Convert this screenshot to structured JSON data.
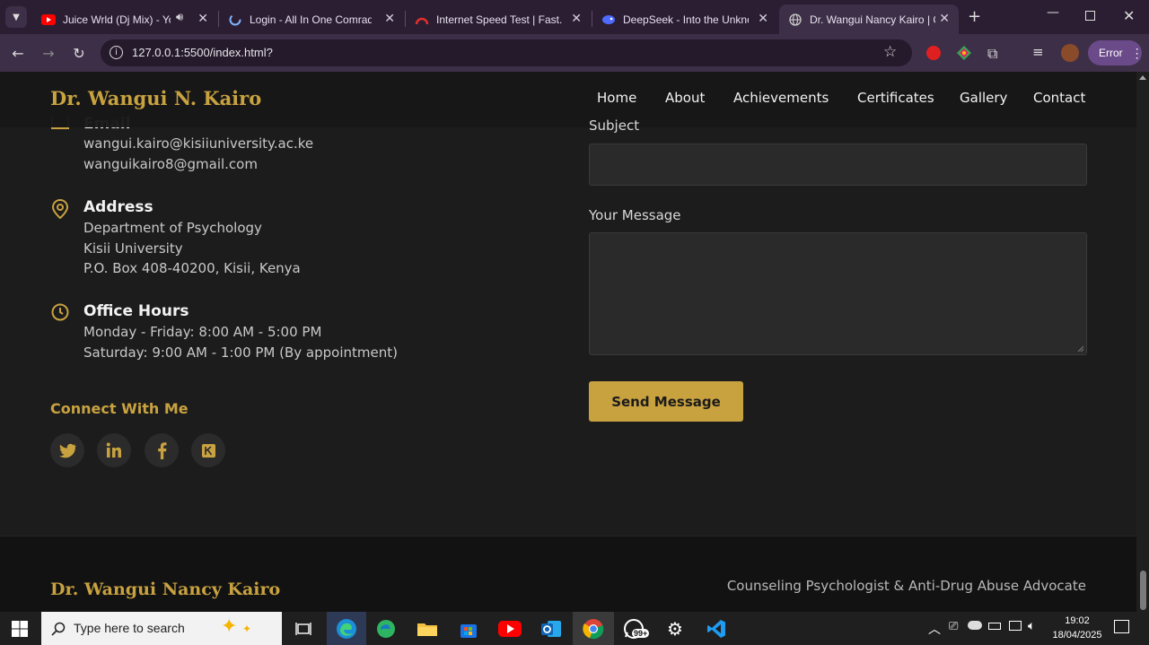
{
  "browser": {
    "tabs": [
      {
        "title": "Juice Wrld (Dj Mix) - You",
        "favicon": "youtube-icon",
        "close": "✕"
      },
      {
        "title": "Login - All In One Comrade",
        "favicon": "loading-icon",
        "close": "✕"
      },
      {
        "title": "Internet Speed Test | Fast.co",
        "favicon": "speedometer-icon",
        "close": "✕"
      },
      {
        "title": "DeepSeek - Into the Unknow",
        "favicon": "deepseek-icon",
        "close": "✕"
      },
      {
        "title": "Dr. Wangui Nancy Kairo | Co",
        "favicon": "globe-icon",
        "close": "✕"
      }
    ],
    "url": "127.0.0.1:5500/index.html?",
    "error_label": "Error",
    "colors": {
      "frame": "#2b1e33",
      "toolbar": "#3d2f47"
    }
  },
  "site": {
    "brand": "Dr. Wangui N. Kairo",
    "nav": [
      "Home",
      "About",
      "Achievements",
      "Certificates",
      "Gallery",
      "Contact"
    ],
    "email": {
      "heading": "Email",
      "lines": [
        "wangui.kairo@kisiiuniversity.ac.ke",
        "wanguikairo8@gmail.com"
      ]
    },
    "address": {
      "heading": "Address",
      "lines": [
        "Department of Psychology",
        "Kisii University",
        "P.O. Box 408-40200, Kisii, Kenya"
      ]
    },
    "hours": {
      "heading": "Office Hours",
      "lines": [
        "Monday - Friday: 8:00 AM - 5:00 PM",
        "Saturday: 9:00 AM - 1:00 PM (By appointment)"
      ]
    },
    "connect_heading": "Connect With Me",
    "social": [
      "twitter-icon",
      "linkedin-icon",
      "facebook-icon",
      "google-scholar-icon"
    ],
    "form": {
      "subject_label": "Subject",
      "message_label": "Your Message",
      "send_label": "Send Message"
    },
    "footer": {
      "brand": "Dr. Wangui Nancy Kairo",
      "tagline": "Counseling Psychologist & Anti-Drug Abuse Advocate"
    },
    "colors": {
      "gold": "#c9a240",
      "background": "#1c1c1c"
    }
  },
  "taskbar": {
    "search_placeholder": "Type here to search",
    "whatsapp_badge": "99+",
    "time": "19:02",
    "date": "18/04/2025"
  }
}
